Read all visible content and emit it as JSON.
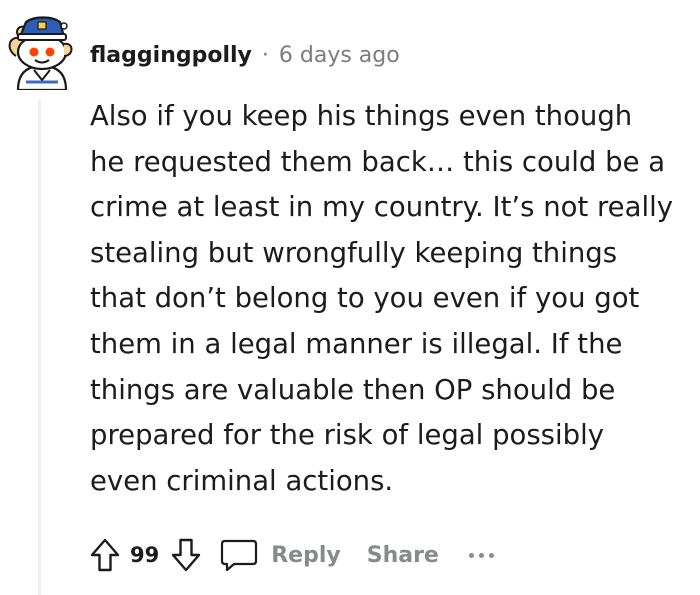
{
  "comment": {
    "username": "flaggingpolly",
    "separator": "·",
    "timestamp": "6 days ago",
    "avatar": "snoo-sailor-avatar",
    "body_lines": [
      "Also if you keep his things even though",
      "he requested them back… this could be a",
      "crime at least in my country. It’s not really",
      "stealing but wrongfully keeping things",
      "that don’t belong to you even if you got",
      "them in a legal manner is illegal. If the",
      "things are valuable then OP should be",
      "prepared for the risk of legal possibly",
      "even criminal actions."
    ]
  },
  "actions": {
    "upvote_icon": "upvote-arrow-icon",
    "score": "99",
    "downvote_icon": "downvote-arrow-icon",
    "reply_icon": "speech-bubble-icon",
    "reply_label": "Reply",
    "share_label": "Share",
    "more_icon": "ellipsis-icon"
  },
  "colors": {
    "text": "#1c1c1c",
    "muted": "#7c7c7c",
    "action_gray": "#878a8c",
    "thread_line": "#edeff1"
  }
}
